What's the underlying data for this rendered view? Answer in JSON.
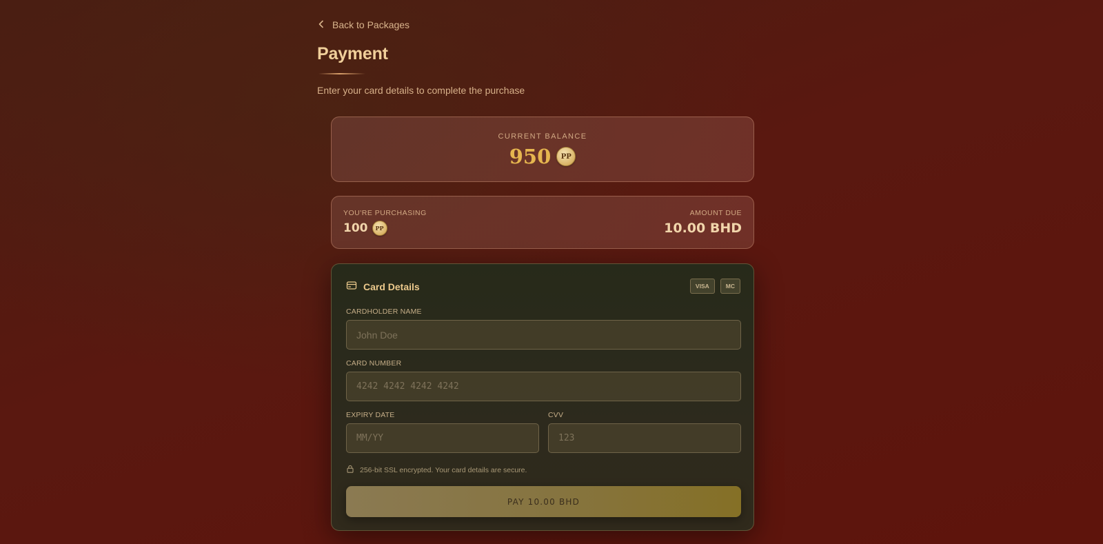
{
  "nav": {
    "back_label": "Back to Packages"
  },
  "header": {
    "title": "Payment",
    "subtitle": "Enter your card details to complete the purchase"
  },
  "balance": {
    "label": "CURRENT BALANCE",
    "amount": "950",
    "coin": "PP"
  },
  "purchase": {
    "purchasing_label": "YOU'RE PURCHASING",
    "purchasing_amount": "100",
    "coin": "PP",
    "due_label": "AMOUNT DUE",
    "due_amount": "10.00 BHD"
  },
  "card_details": {
    "title": "Card Details",
    "brands": [
      "VISA",
      "MC"
    ],
    "cardholder": {
      "label": "CARDHOLDER NAME",
      "value": "",
      "placeholder": "John Doe"
    },
    "number": {
      "label": "CARD NUMBER",
      "value": "",
      "placeholder": "4242 4242 4242 4242"
    },
    "expiry": {
      "label": "EXPIRY DATE",
      "value": "",
      "placeholder": "MM/YY"
    },
    "cvv": {
      "label": "CVV",
      "value": "",
      "placeholder": "123"
    },
    "secure_note": "256-bit SSL encrypted. Your card details are secure.",
    "pay_label": "PAY 10.00 BHD"
  },
  "colors": {
    "accent_gold": "#e6b64f",
    "background": "#5a1810",
    "panel": "#2b2a1c",
    "pay_button": "#857026"
  },
  "icons": [
    "chevron-left-icon",
    "credit-card-icon",
    "lock-icon",
    "pp-coin-icon"
  ]
}
